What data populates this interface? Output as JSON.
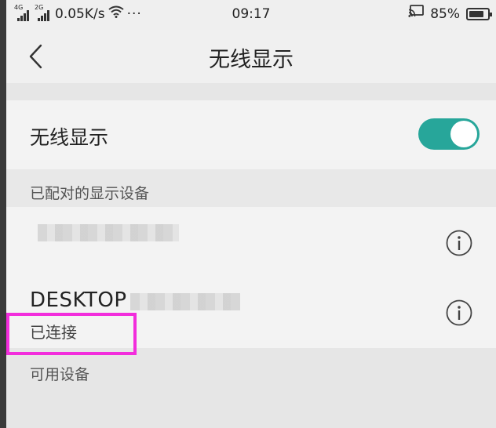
{
  "status_bar": {
    "sim1_tag": "4G",
    "sim2_tag": "2G",
    "net_speed": "0.05K/s",
    "more": "···",
    "time": "09:17",
    "battery_percent": "85%",
    "battery_level": 0.85
  },
  "header": {
    "title": "无线显示"
  },
  "wireless_display": {
    "label": "无线显示",
    "enabled": true,
    "accent": "#27a69a"
  },
  "paired_section": {
    "title": "已配对的显示设备",
    "devices": [
      {
        "name": "",
        "status": ""
      },
      {
        "name": "DESKTOP",
        "status": "已连接"
      }
    ]
  },
  "available_section": {
    "title": "可用设备"
  },
  "highlight_color": "#f22ddc"
}
